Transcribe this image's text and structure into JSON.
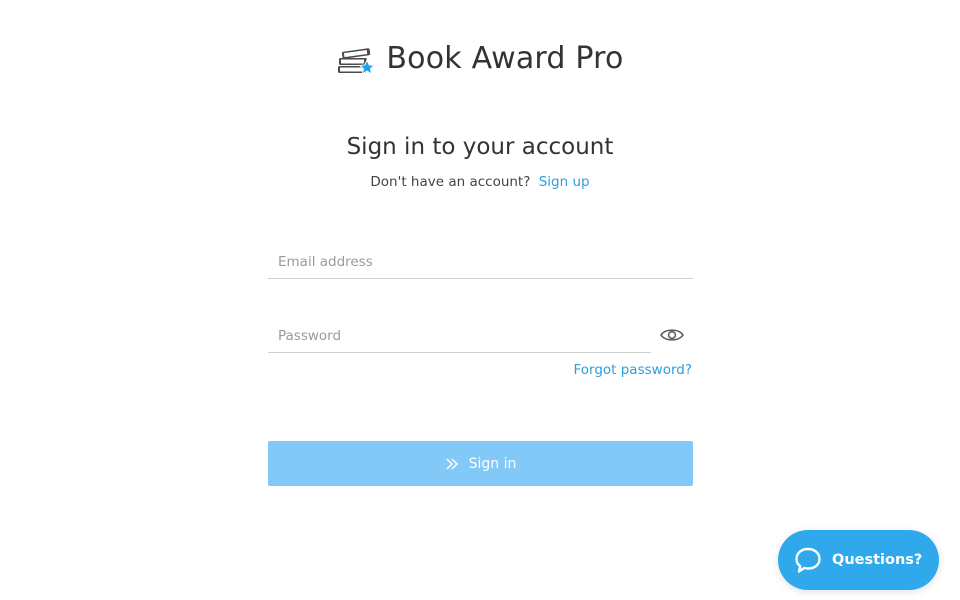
{
  "brand": {
    "name": "Book Award Pro",
    "logo_icon": "books-star-icon"
  },
  "signin": {
    "heading": "Sign in to your account",
    "no_account_text": "Don't have an account?",
    "signup_link": "Sign up",
    "email_placeholder": "Email address",
    "email_value": "",
    "password_placeholder": "Password",
    "password_value": "",
    "show_password_icon": "eye-icon",
    "forgot_link": "Forgot password?",
    "submit_label": "Sign in",
    "submit_icon": "double-chevron-right-icon"
  },
  "help": {
    "label": "Questions?",
    "icon": "chat-bubble-icon"
  },
  "colors": {
    "accent": "#2d9fd9",
    "button_bg": "#82c9f7",
    "help_bg": "#2fa9ec",
    "logo_star": "#1aa3ea",
    "logo_books": "#4a4a4a"
  }
}
